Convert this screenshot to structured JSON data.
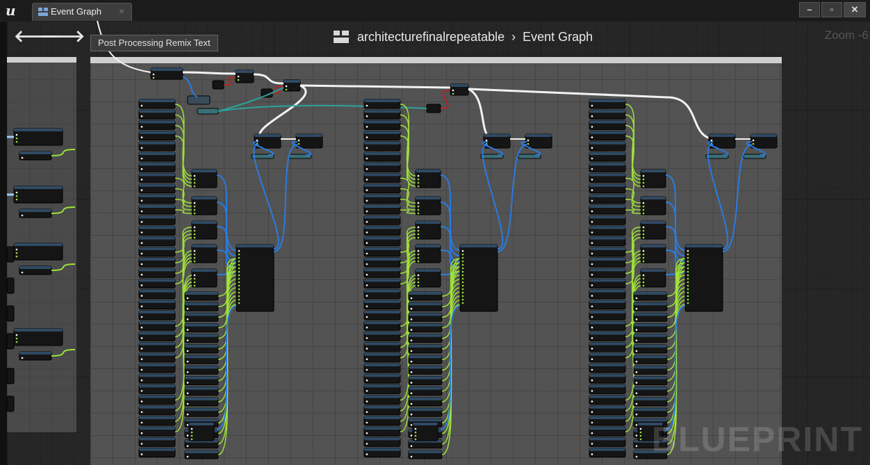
{
  "window": {
    "tab_label": "Event Graph",
    "tab_close": "×",
    "controls": [
      "–",
      "▫",
      "✕"
    ]
  },
  "nav": {
    "back_icon": "arrow-left",
    "forward_icon": "arrow-right",
    "tooltip": "Post Processing Remix Text"
  },
  "breadcrumb": {
    "blueprint": "architecturefinalrepeatable",
    "separator": "›",
    "graph": "Event Graph"
  },
  "zoom": "Zoom -6",
  "watermark": "BLUEPRINT",
  "colors": {
    "exec_wire": "#f2f2f2",
    "float_wire": "#9ee03a",
    "object_wire": "#2a7be0",
    "struct_wire": "#2aa39a",
    "bool_wire": "#b22424",
    "node_body": "#151515",
    "node_header": "#2f4a63"
  }
}
